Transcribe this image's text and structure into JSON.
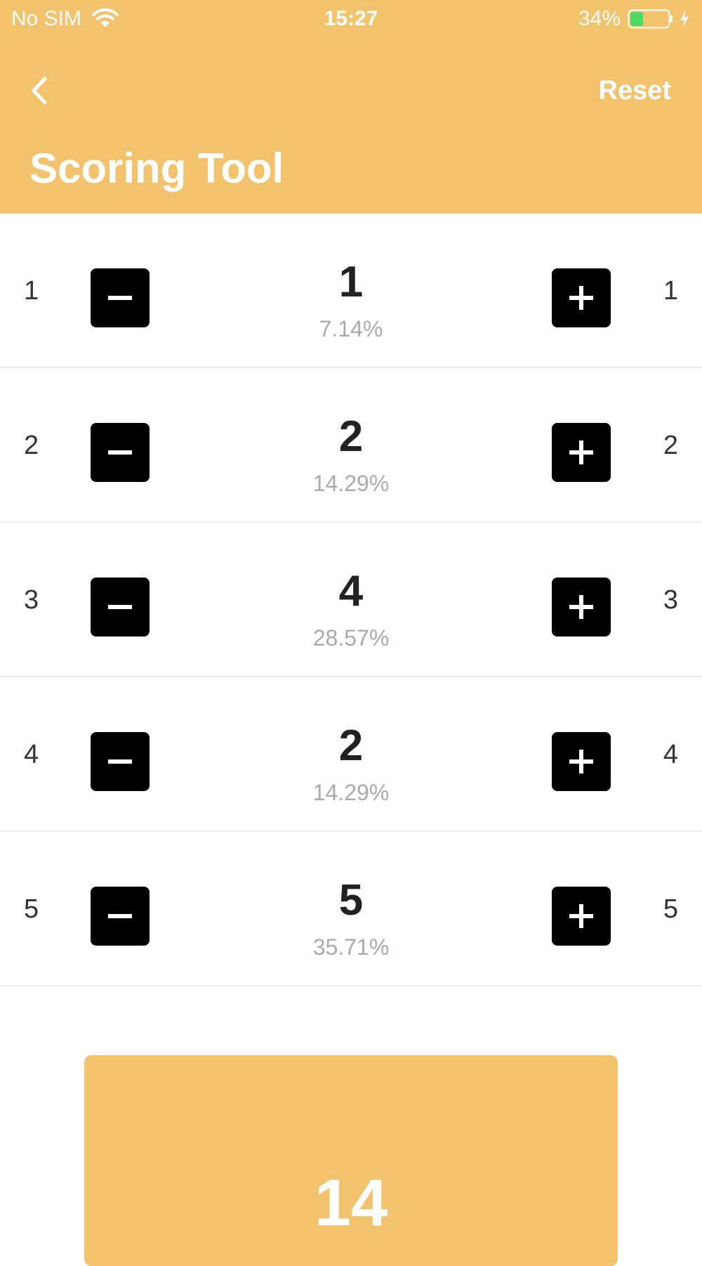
{
  "colors": {
    "accent": "#F2C26D",
    "button_bg": "#000000",
    "percent_text": "#aaaaaa",
    "battery_fill": "#4cd964"
  },
  "status_bar": {
    "carrier": "No SIM",
    "time": "15:27",
    "battery": "34%",
    "battery_level": 0.34
  },
  "nav": {
    "back_icon": "chevron-left-icon",
    "reset_label": "Reset"
  },
  "title": "Scoring Tool",
  "rows": [
    {
      "label": "1",
      "count": "1",
      "percent": "7.14%"
    },
    {
      "label": "2",
      "count": "2",
      "percent": "14.29%"
    },
    {
      "label": "3",
      "count": "4",
      "percent": "28.57%"
    },
    {
      "label": "4",
      "count": "2",
      "percent": "14.29%"
    },
    {
      "label": "5",
      "count": "5",
      "percent": "35.71%"
    }
  ],
  "total": "14"
}
